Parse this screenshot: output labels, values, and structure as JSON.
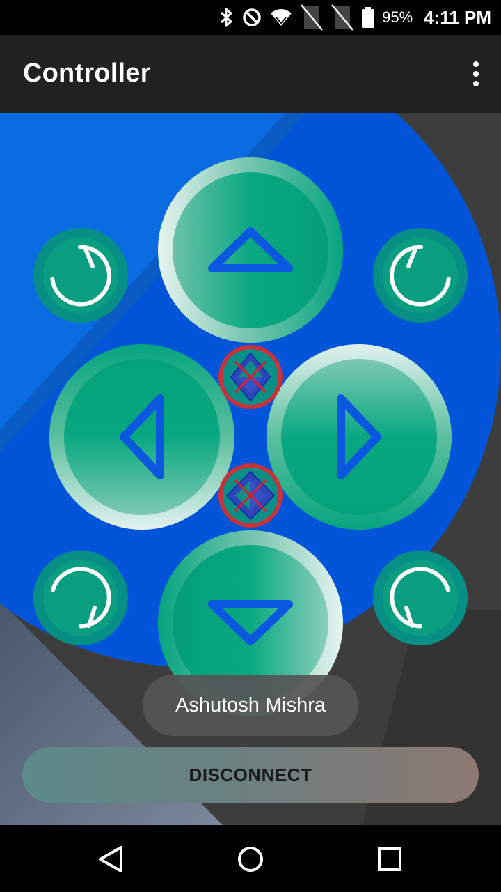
{
  "status_bar": {
    "battery_percent": "95%",
    "time": "4:11 PM"
  },
  "app_bar": {
    "title": "Controller",
    "overflow_icon": "more-vert-icon"
  },
  "controller": {
    "buttons": [
      {
        "name": "up-button",
        "icon": "triangle-up-icon"
      },
      {
        "name": "down-button",
        "icon": "triangle-down-icon"
      },
      {
        "name": "left-button",
        "icon": "triangle-left-icon"
      },
      {
        "name": "right-button",
        "icon": "triangle-right-icon"
      },
      {
        "name": "rotate-top-left-button",
        "icon": "rotate-icon"
      },
      {
        "name": "rotate-top-right-button",
        "icon": "rotate-icon"
      },
      {
        "name": "rotate-bottom-left-button",
        "icon": "rotate-icon"
      },
      {
        "name": "rotate-bottom-right-button",
        "icon": "rotate-icon"
      },
      {
        "name": "stop-vertical-button",
        "icon": "disabled-vertical-icon"
      },
      {
        "name": "stop-horizontal-button",
        "icon": "disabled-horizontal-icon"
      }
    ]
  },
  "toast": {
    "text": "Ashutosh Mishra"
  },
  "disconnect": {
    "label": "DISCONNECT"
  },
  "colors": {
    "blue": "#0055dd",
    "green": "#02a37b",
    "app_bar": "#212121"
  },
  "nav": {
    "back_icon": "back-triangle-icon",
    "home_icon": "home-circle-icon",
    "recents_icon": "recents-square-icon"
  }
}
